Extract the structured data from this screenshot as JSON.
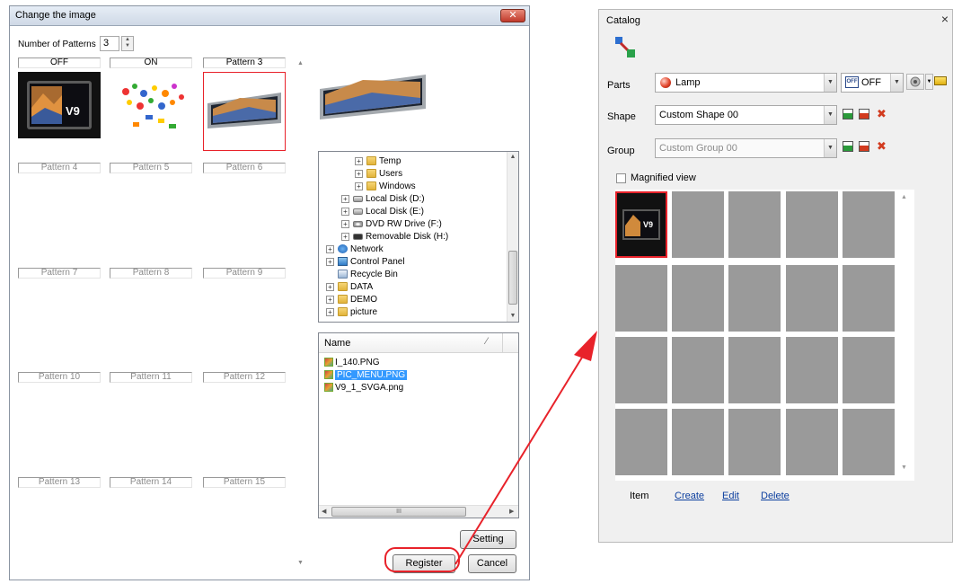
{
  "dialog": {
    "title": "Change the image",
    "close_label": "✕",
    "num_patterns_label": "Number of Patterns",
    "num_patterns_value": "3",
    "patterns": [
      "OFF",
      "ON",
      "Pattern 3",
      "Pattern 4",
      "Pattern 5",
      "Pattern 6",
      "Pattern 7",
      "Pattern 8",
      "Pattern 9",
      "Pattern 10",
      "Pattern 11",
      "Pattern 12",
      "Pattern 13",
      "Pattern 14",
      "Pattern 15"
    ],
    "logo_text": "V9",
    "tree": {
      "items": [
        {
          "label": "Temp",
          "icon": "folder-icon"
        },
        {
          "label": "Users",
          "icon": "folder-icon"
        },
        {
          "label": "Windows",
          "icon": "folder-icon"
        },
        {
          "label": "Local Disk (D:)",
          "icon": "disk-icon"
        },
        {
          "label": "Local Disk (E:)",
          "icon": "disk-icon"
        },
        {
          "label": "DVD RW Drive (F:)",
          "icon": "dvd-icon"
        },
        {
          "label": "Removable Disk (H:)",
          "icon": "removable-icon"
        },
        {
          "label": "Network",
          "icon": "network-icon"
        },
        {
          "label": "Control Panel",
          "icon": "control-panel-icon"
        },
        {
          "label": "Recycle Bin",
          "icon": "recycle-bin-icon"
        },
        {
          "label": "DATA",
          "icon": "folder-icon"
        },
        {
          "label": "DEMO",
          "icon": "folder-icon"
        },
        {
          "label": "picture",
          "icon": "folder-icon"
        }
      ]
    },
    "files": {
      "header": "Name",
      "items": [
        "I_140.PNG",
        "PIC_MENU.PNG",
        "V9_1_SVGA.png"
      ],
      "selected_index": 1
    },
    "hscroll_grip": "III",
    "setting_label": "Setting",
    "register_label": "Register",
    "cancel_label": "Cancel"
  },
  "catalog": {
    "title": "Catalog",
    "close_label": "×",
    "parts_label": "Parts",
    "parts_value": "Lamp",
    "parts_state": "OFF",
    "off_badge": "OFF",
    "shape_label": "Shape",
    "shape_value": "Custom Shape 00",
    "group_label": "Group",
    "group_value": "Custom Group 00",
    "magnified_label": "Magnified view",
    "thumb_logo": "V9",
    "item_label": "Item",
    "create_label": "Create",
    "edit_label": "Edit",
    "delete_label": "Delete"
  },
  "colors": {
    "highlight_red": "#e8222a",
    "selection_blue": "#3399ff",
    "link_blue": "#0b3e9e",
    "grid_gray": "#9a9a9a"
  }
}
